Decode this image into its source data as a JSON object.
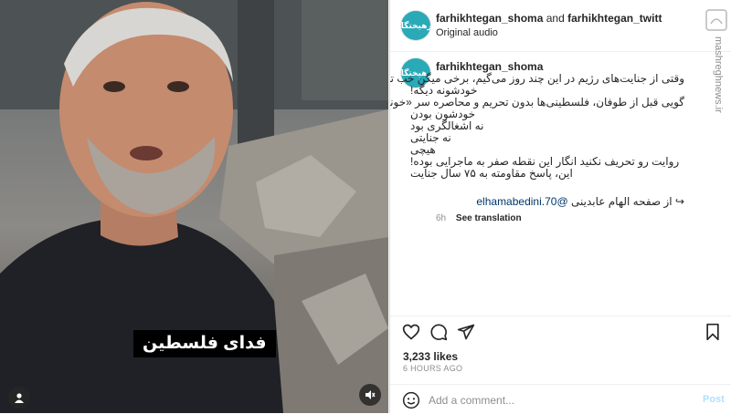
{
  "media": {
    "subtitle": "فدای فلسطین"
  },
  "header": {
    "account_a": "farhikhtegan_shoma",
    "and": "and",
    "account_b": "farhikhtegan_twitt",
    "audio": "Original audio",
    "avatar_text": "فرهیختگان"
  },
  "caption": {
    "username": "farhikhtegan_shoma",
    "lines": [
      "وقتی از جنایت‌های رژیم در این چند روز می‌گیم، برخی میگن خب تقصیر",
      "خودشونه دیگه!",
      "گویی قبل از طوفان، فلسطینی‌ها بدون تحریم و محاصره سر «خونه»",
      "خودشون بودن",
      "نه اشغالگری بود",
      "نه جنایتی",
      "هیچی",
      "روایت رو تحریف نکنید انگار این نقطه صفر به ماجرایی بوده!",
      "این، پاسخ مقاومته به ۷۵ سال جنایت"
    ],
    "credit_text": "از صفحه الهام عابدینی",
    "credit_mention": "@elhamabedini.70",
    "credit_link": "↪",
    "age": "6h",
    "see_translation": "See translation"
  },
  "stats": {
    "likes": "3,233 likes",
    "time_ago": "6 HOURS AGO"
  },
  "comment": {
    "placeholder": "Add a comment...",
    "post": "Post"
  },
  "watermark": "mashreghnews.ir",
  "icons": [
    "heart-icon",
    "comment-icon",
    "share-icon",
    "bookmark-icon",
    "emoji-icon",
    "user-tag-icon",
    "speaker-muted-icon"
  ]
}
